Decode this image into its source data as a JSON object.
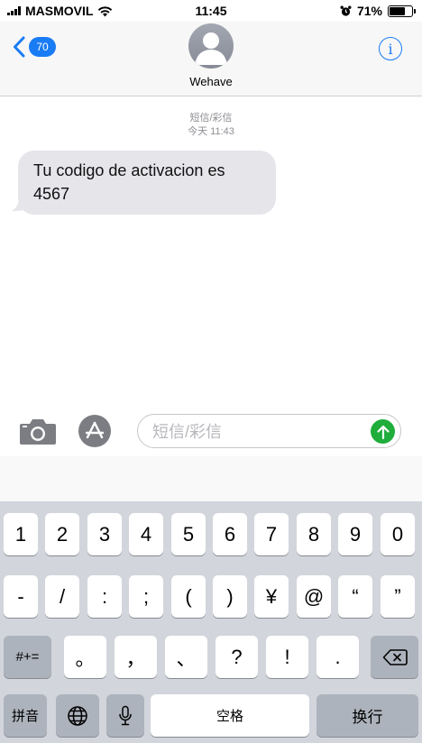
{
  "status_bar": {
    "carrier": "MASMOVIL",
    "time": "11:45",
    "battery_percent": "71%",
    "battery_level": 0.71
  },
  "header": {
    "back_count": "70",
    "contact_name": "Wehave",
    "info_label": "i"
  },
  "conversation": {
    "service_label": "短信/彩信",
    "timestamp": "今天 11:43",
    "messages": [
      {
        "text": "Tu codigo de activacion es 4567",
        "incoming": true
      }
    ]
  },
  "compose": {
    "placeholder": "短信/彩信"
  },
  "keyboard": {
    "row1": [
      "1",
      "2",
      "3",
      "4",
      "5",
      "6",
      "7",
      "8",
      "9",
      "0"
    ],
    "row2": [
      "-",
      "/",
      ":",
      ";",
      "(",
      ")",
      "¥",
      "@",
      "“",
      "”"
    ],
    "row3": [
      "#+=",
      "。",
      "，",
      "、",
      "?",
      "!",
      ".",
      "⌫"
    ],
    "row4": {
      "pinyin": "拼音",
      "globe": "globe-icon",
      "mic": "microphone-icon",
      "space": "空格",
      "return": "换行"
    }
  },
  "colors": {
    "accent_blue": "#1a7cf5",
    "send_green": "#1fad3c",
    "bubble_gray": "#e5e5ea",
    "keyboard_bg": "#d2d5db"
  }
}
